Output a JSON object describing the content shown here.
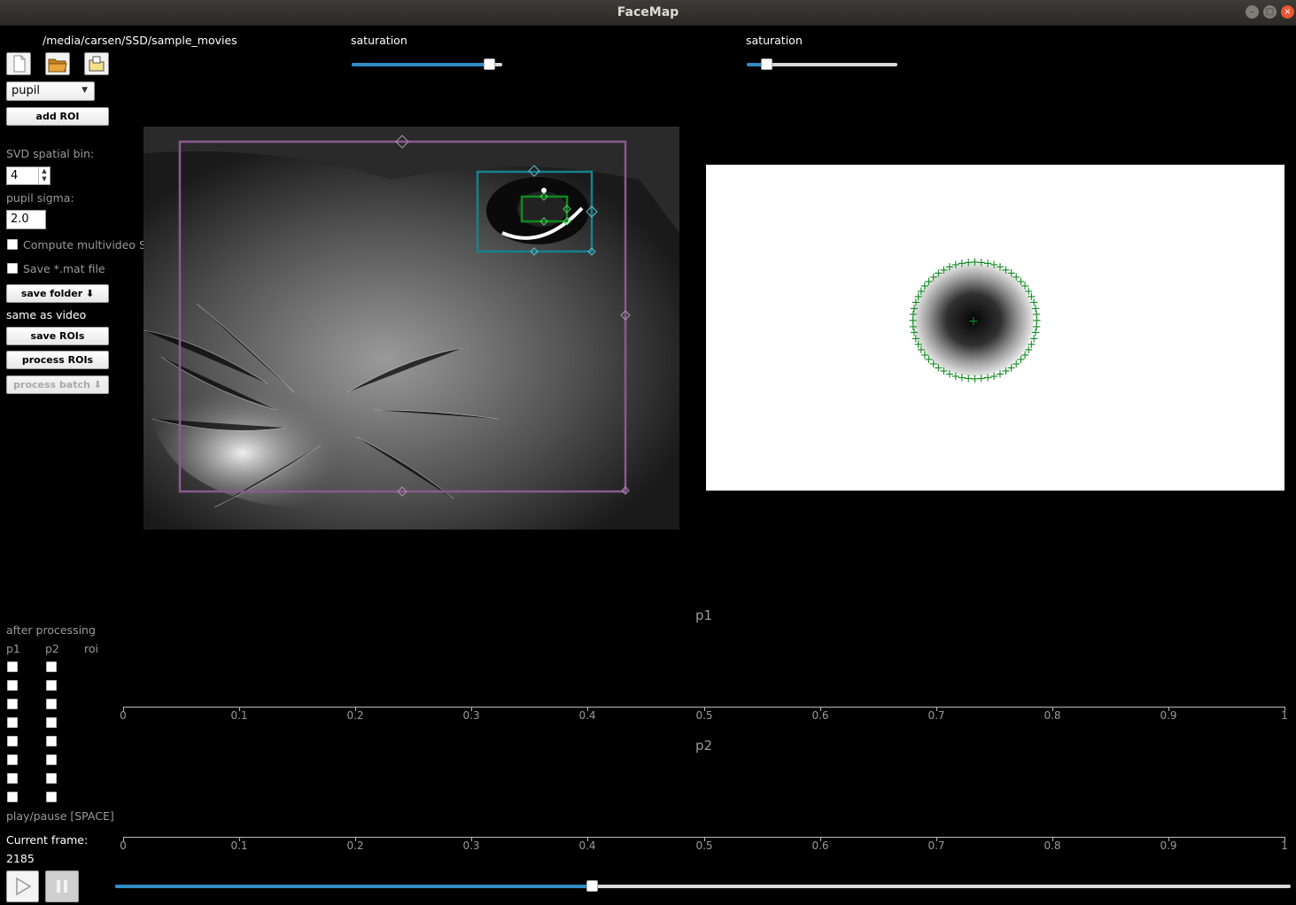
{
  "window": {
    "title": "FaceMap"
  },
  "file_path": "/media/carsen/SSD/sample_movies",
  "toolbar": {
    "icons": [
      "new-file-icon",
      "open-folder-icon",
      "open-proc-icon"
    ]
  },
  "roi_type": {
    "selected": "pupil"
  },
  "buttons": {
    "add_roi": "add ROI",
    "save_folder": "save folder ⬇",
    "save_rois": "save ROIs",
    "process_rois": "process ROIs",
    "process_batch": "process batch ⬇"
  },
  "settings": {
    "svd_bin_label": "SVD spatial bin:",
    "svd_bin_value": "4",
    "pupil_sigma_label": "pupil sigma:",
    "pupil_sigma_value": "2.0",
    "multivideo_label": "Compute multivideo SVD",
    "save_mat_label": "Save *.mat file",
    "save_location": "same as video"
  },
  "saturation": {
    "left": {
      "label": "saturation",
      "value": 0.95
    },
    "right": {
      "label": "saturation",
      "value": 0.1
    }
  },
  "after_processing": {
    "label": "after processing",
    "col_p1": "p1",
    "col_p2": "p2",
    "col_roi": "roi"
  },
  "plots": {
    "p1_title": "p1",
    "p2_title": "p2",
    "ticks": [
      "0",
      "0.1",
      "0.2",
      "0.3",
      "0.4",
      "0.5",
      "0.6",
      "0.7",
      "0.8",
      "0.9",
      "1"
    ]
  },
  "playback": {
    "hint": "play/pause [SPACE]",
    "current_frame_label": "Current frame:",
    "current_frame": "2185",
    "progress": 0.405
  },
  "colors": {
    "accent": "#308cc6",
    "roi_face": "#8a5a8e",
    "roi_eye": "#16808f",
    "roi_pupil": "#0e8a1e"
  }
}
